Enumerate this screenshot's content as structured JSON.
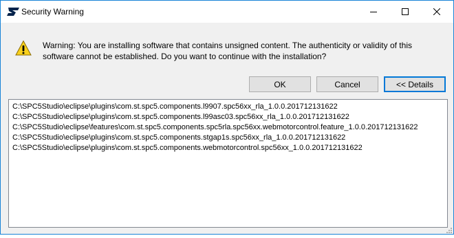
{
  "window": {
    "title": "Security Warning",
    "logo_icon": "st-logo-icon",
    "controls": {
      "minimize_icon": "minimize-icon",
      "maximize_icon": "maximize-icon",
      "close_icon": "close-icon"
    }
  },
  "dialog": {
    "icon": "warning-icon",
    "message": "Warning: You are installing software that contains unsigned content. The authenticity or validity of this software cannot be established. Do you want to continue with the installation?",
    "buttons": {
      "ok": "OK",
      "cancel": "Cancel",
      "details": "<< Details"
    }
  },
  "details": {
    "items": [
      "C:\\SPC5Studio\\eclipse\\plugins\\com.st.spc5.components.l9907.spc56xx_rla_1.0.0.201712131622",
      "C:\\SPC5Studio\\eclipse\\plugins\\com.st.spc5.components.l99asc03.spc56xx_rla_1.0.0.201712131622",
      "C:\\SPC5Studio\\eclipse\\features\\com.st.spc5.components.spc5rla.spc56xx.webmotorcontrol.feature_1.0.0.201712131622",
      "C:\\SPC5Studio\\eclipse\\plugins\\com.st.spc5.components.stgap1s.spc56xx_rla_1.0.0.201712131622",
      "C:\\SPC5Studio\\eclipse\\plugins\\com.st.spc5.components.webmotorcontrol.spc56xx_1.0.0.201712131622"
    ]
  },
  "colors": {
    "accent": "#0078d7",
    "st_logo": "#03234b",
    "warning_fill": "#f9d11c"
  }
}
